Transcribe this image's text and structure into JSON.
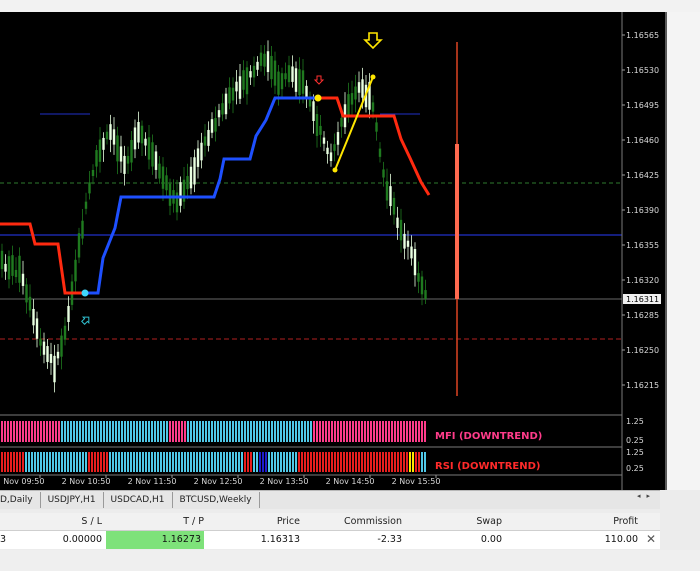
{
  "price_scale": {
    "ticks": [
      "1.16565",
      "1.16530",
      "1.16495",
      "1.16460",
      "1.16425",
      "1.16390",
      "1.16355",
      "1.16320",
      "1.16285",
      "1.16250",
      "1.16215"
    ],
    "current_price_tag": "1.16311"
  },
  "time_scale": {
    "labels": [
      "2 Nov 09:50",
      "2 Nov 10:50",
      "2 Nov 11:50",
      "2 Nov 12:50",
      "2 Nov 13:50",
      "2 Nov 14:50",
      "2 Nov 15:50"
    ]
  },
  "indicators": {
    "mfi_label": "MFI (DOWNTREND)",
    "rsi_label": "RSI (DOWNTREND)",
    "scale_top": "1.25",
    "scale_bottom": "0.25"
  },
  "tabs": [
    {
      "label": "D,Daily"
    },
    {
      "label": "USDJPY,H1"
    },
    {
      "label": "USDCAD,H1"
    },
    {
      "label": "BTCUSD,Weekly"
    }
  ],
  "table": {
    "headers": {
      "sl": "S / L",
      "tp": "T / P",
      "price": "Price",
      "commission": "Commission",
      "swap": "Swap",
      "profit": "Profit"
    },
    "row": {
      "first": "3",
      "sl": "0.00000",
      "tp": "1.16273",
      "price": "1.16313",
      "commission": "-2.33",
      "swap": "0.00",
      "profit": "110.00"
    }
  },
  "icons": {
    "close": "close-icon",
    "tab_scroll": "scroll-arrows-icon",
    "buy_arrow": "arrow-down-icon"
  },
  "colors": {
    "background": "#000000",
    "candle_up": "#e8ffe0",
    "candle_down": "#1f7a1f",
    "trend_up": "#1e50ff",
    "trend_down": "#ff2a10",
    "signal_line": "#ffe600",
    "h_line_blue": "#2030c8",
    "h_line_green": "#2e7a2e",
    "h_line_red": "#b02020",
    "tp_highlight": "#7ee27a",
    "mfi_bars": [
      "#ff3c8a",
      "#4fc8e8"
    ],
    "rsi_bars": [
      "#e81e1e",
      "#4fc8e8",
      "#1e1ecc",
      "#ffe600"
    ]
  }
}
